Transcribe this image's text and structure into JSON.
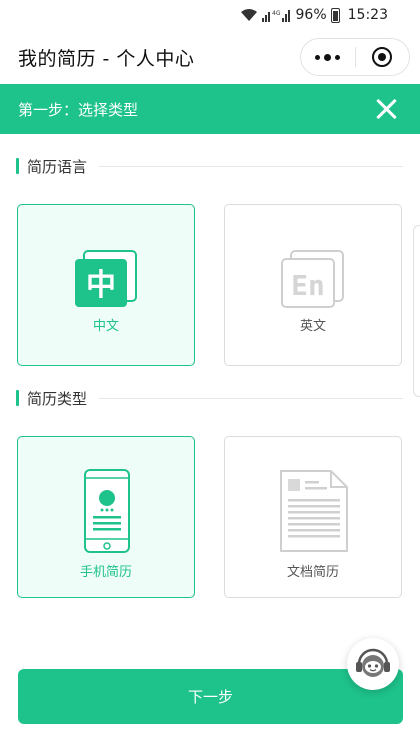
{
  "status_bar": {
    "battery": "96%",
    "time": "15:23",
    "network": "4G"
  },
  "nav": {
    "title": "我的简历 - 个人中心"
  },
  "step": {
    "title": "第一步：选择类型"
  },
  "language_section": {
    "label": "简历语言",
    "options": [
      {
        "label": "中文",
        "glyph": "中",
        "selected": true
      },
      {
        "label": "英文",
        "glyph": "En",
        "selected": false
      }
    ]
  },
  "type_section": {
    "label": "简历类型",
    "options": [
      {
        "label": "手机简历",
        "selected": true
      },
      {
        "label": "文档简历",
        "selected": false
      }
    ]
  },
  "next_button": {
    "label": "下一步"
  },
  "colors": {
    "accent": "#1ec28b",
    "selected_bg": "#effdf8",
    "border": "#dcdcdc"
  }
}
